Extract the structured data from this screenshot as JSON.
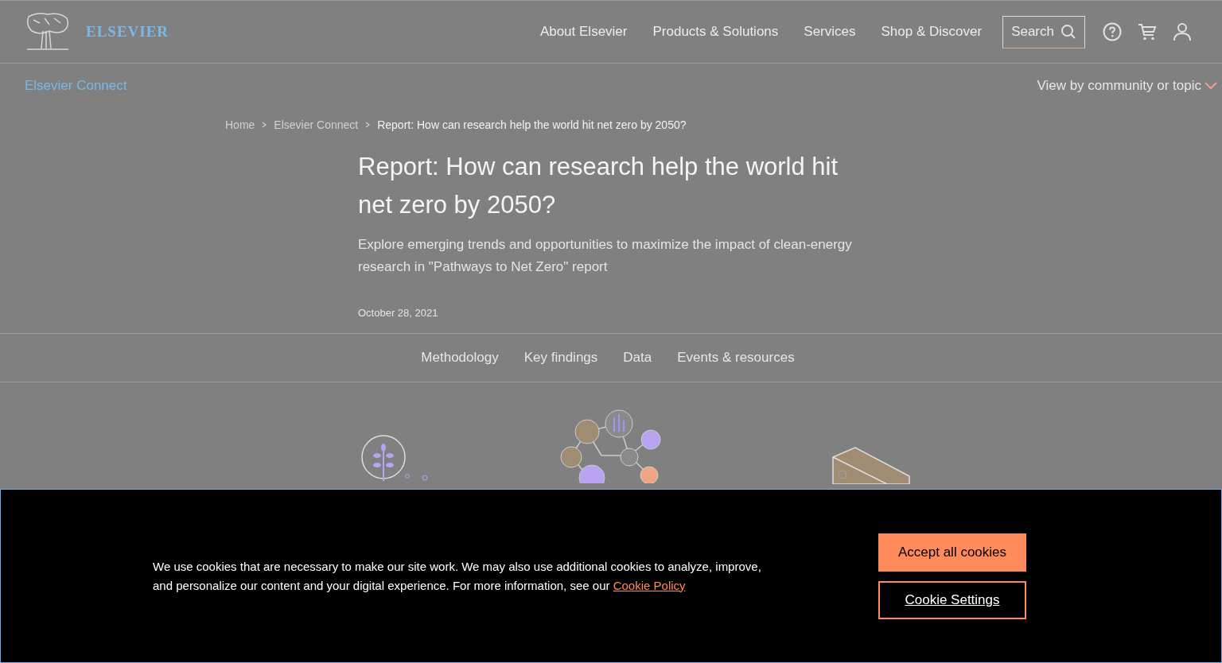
{
  "header": {
    "logo_text": "ELSEVIER",
    "nav": [
      "About Elsevier",
      "Products & Solutions",
      "Services",
      "Shop & Discover"
    ],
    "search": {
      "label": "Search"
    }
  },
  "subnav": {
    "title": "Elsevier Connect",
    "menu": "View by community or topic"
  },
  "breadcrumbs": [
    "Home",
    "Elsevier Connect",
    "Report: How can research help the world hit net zero by 2050?"
  ],
  "article": {
    "title": "Report: How can research help the world hit net zero by 2050?",
    "subtitle": "Explore emerging trends and opportunities to maximize the impact of clean-energy research in \"Pathways to Net Zero\" report",
    "date": "October 28, 2021"
  },
  "section_tabs": [
    "Methodology",
    "Key findings",
    "Data",
    "Events & resources"
  ],
  "cookie_banner": {
    "text": "We use cookies that are necessary to make our site work. We may also use additional cookies to analyze, improve, and personalize our content and your digital experience. For more information, see our",
    "link": "Cookie Policy",
    "buttons": [
      {
        "label": "Accept all cookies",
        "kind": "primary"
      },
      {
        "label": "Cookie Settings",
        "kind": "secondary"
      }
    ]
  }
}
